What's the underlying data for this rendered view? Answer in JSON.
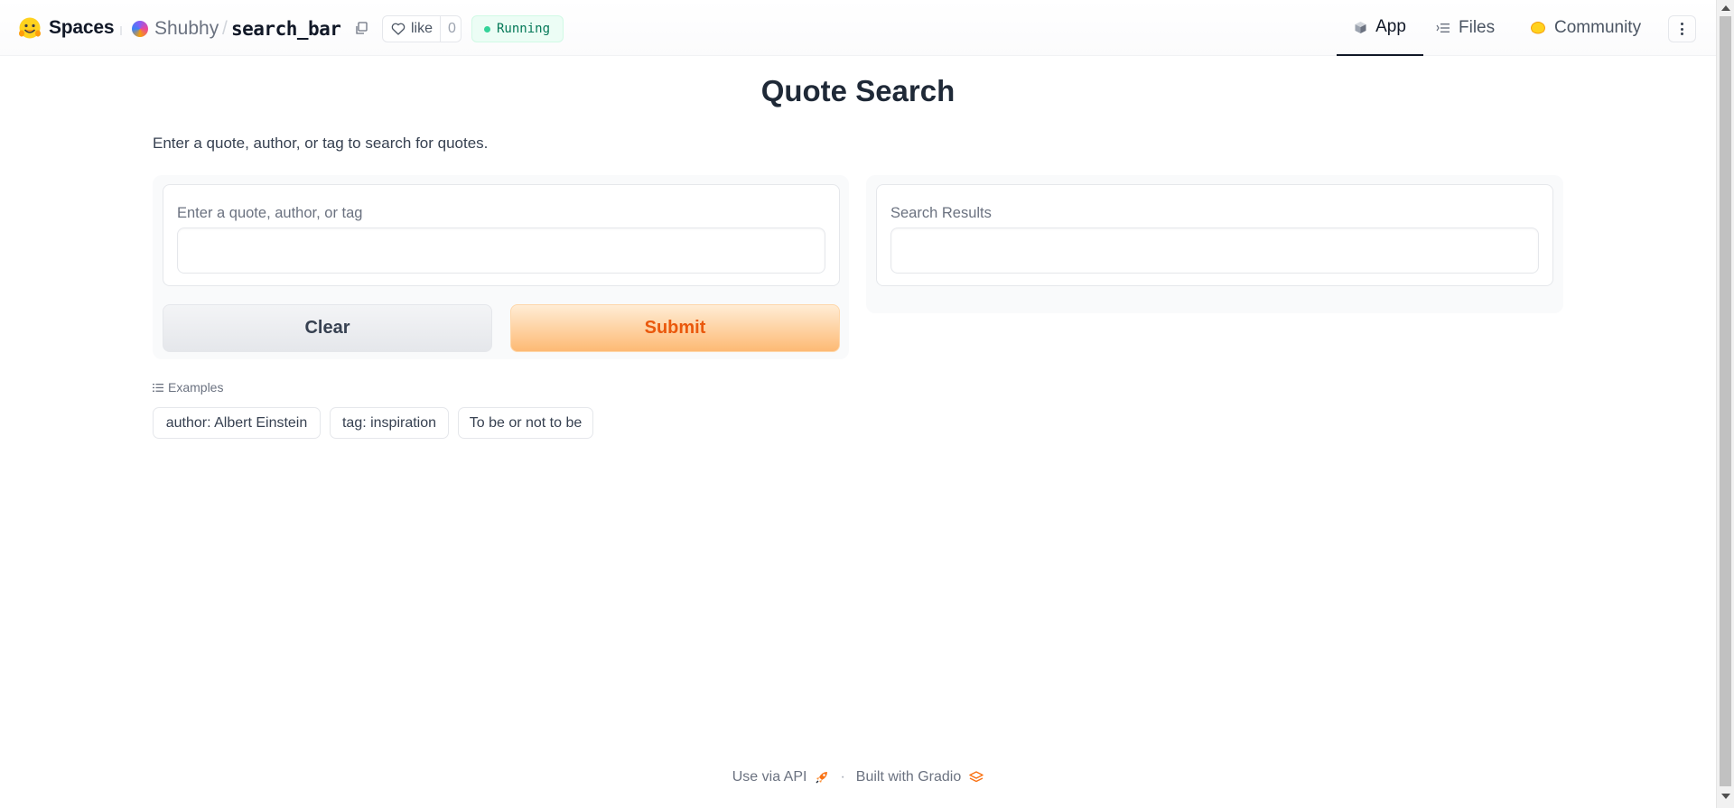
{
  "header": {
    "brand": "Spaces",
    "owner": "Shubhy",
    "separator": "/",
    "repo": "search_bar",
    "like_label": "like",
    "like_count": "0",
    "status": "Running",
    "nav": {
      "app": "App",
      "files": "Files",
      "community": "Community"
    }
  },
  "main": {
    "title": "Quote Search",
    "description": "Enter a quote, author, or tag to search for quotes.",
    "input": {
      "label": "Enter a quote, author, or tag",
      "value": ""
    },
    "output": {
      "label": "Search Results",
      "value": ""
    },
    "buttons": {
      "clear": "Clear",
      "submit": "Submit"
    },
    "examples": {
      "heading": "Examples",
      "items": [
        "author: Albert Einstein",
        "tag: inspiration",
        "To be or not to be"
      ]
    }
  },
  "footer": {
    "api": "Use via API",
    "separator": "·",
    "built": "Built with Gradio"
  },
  "colors": {
    "accent": "#ea580c",
    "status_green": "#34d399",
    "submit_gradient_end": "#fdba74"
  },
  "icons": [
    "hugging-face-icon",
    "copy-icon",
    "heart-icon",
    "cube-icon",
    "files-icon",
    "community-icon",
    "more-vertical-icon",
    "list-icon",
    "rocket-icon",
    "gradio-logo-icon"
  ]
}
